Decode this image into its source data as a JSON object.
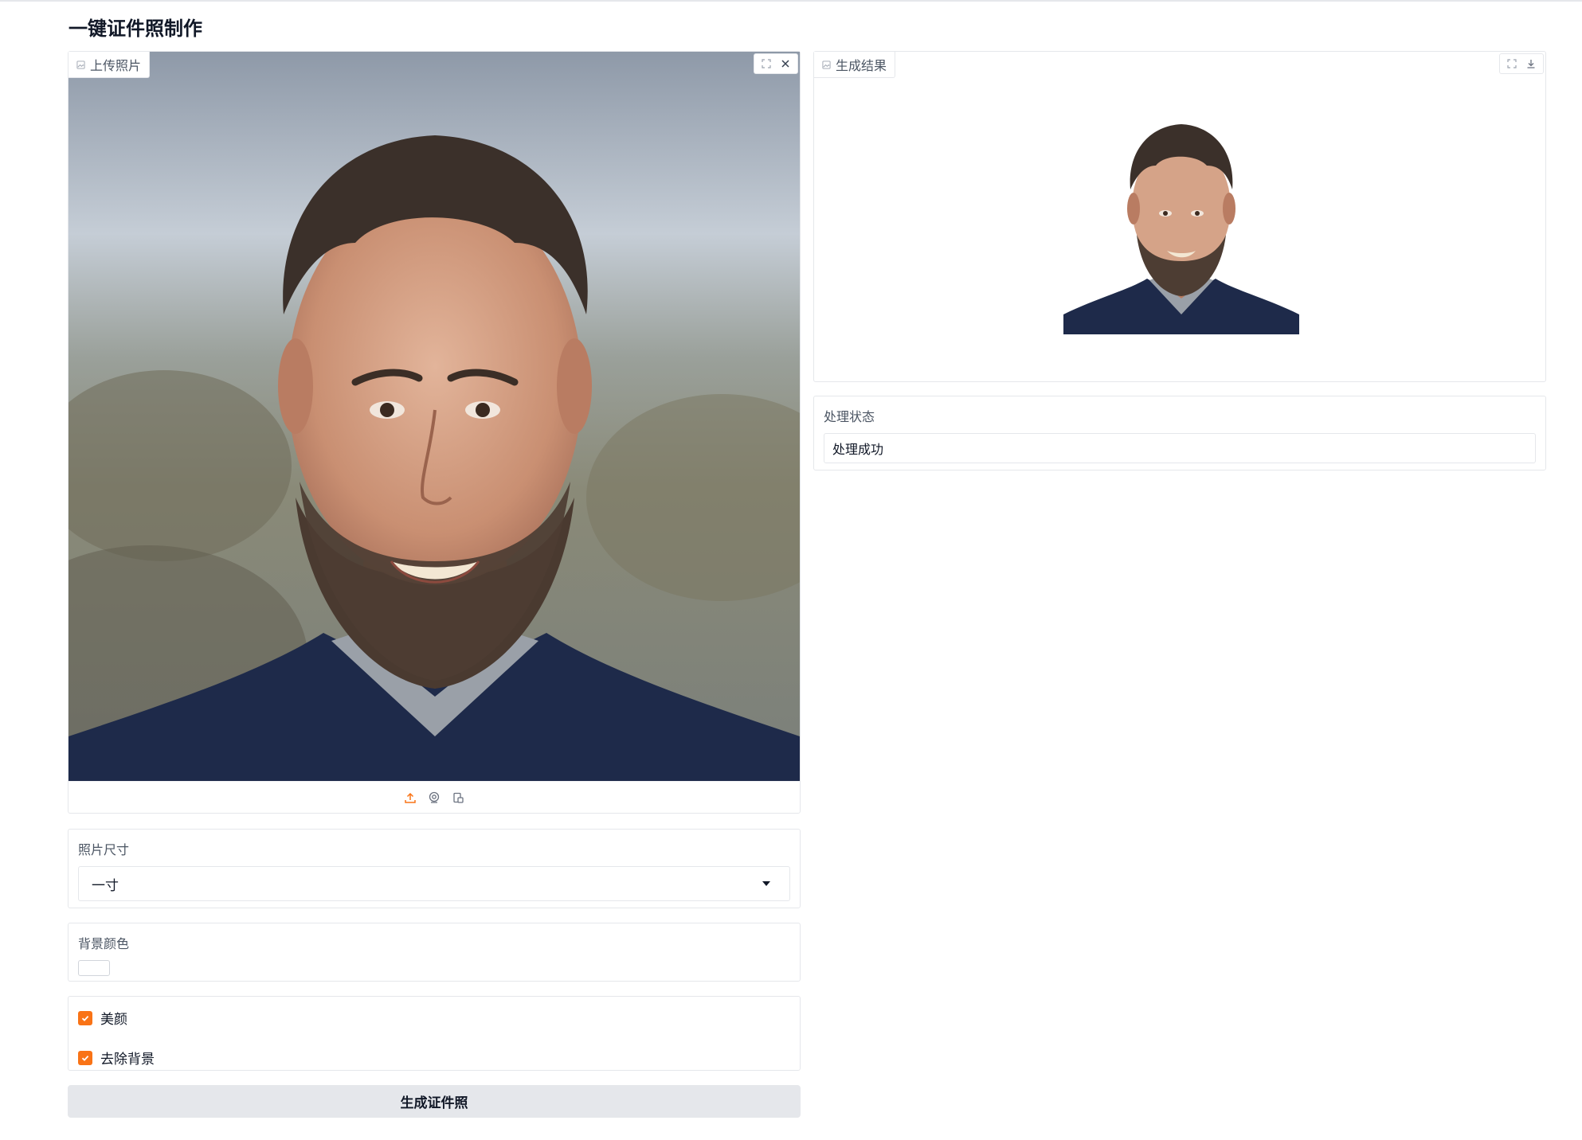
{
  "app": {
    "title": "一键证件照制作"
  },
  "upload_panel": {
    "label": "上传照片",
    "icons": {
      "label_icon": "image-icon",
      "fullscreen": "fullscreen-icon",
      "clear": "close-icon",
      "sources": [
        "upload-icon",
        "webcam-icon",
        "clipboard-icon"
      ]
    },
    "accent_color": "#f97316"
  },
  "result_panel": {
    "label": "生成结果",
    "icons": {
      "label_icon": "image-icon",
      "fullscreen": "fullscreen-icon",
      "download": "download-icon"
    }
  },
  "status": {
    "label": "处理状态",
    "value": "处理成功"
  },
  "photo_size": {
    "label": "照片尺寸",
    "selected": "一寸"
  },
  "background_color": {
    "label": "背景颜色",
    "value": "#ffffff"
  },
  "options": [
    {
      "label": "美颜",
      "checked": true
    },
    {
      "label": "去除背景",
      "checked": true
    }
  ],
  "checkbox_color": "#f97316",
  "generate_button": {
    "label": "生成证件照"
  }
}
